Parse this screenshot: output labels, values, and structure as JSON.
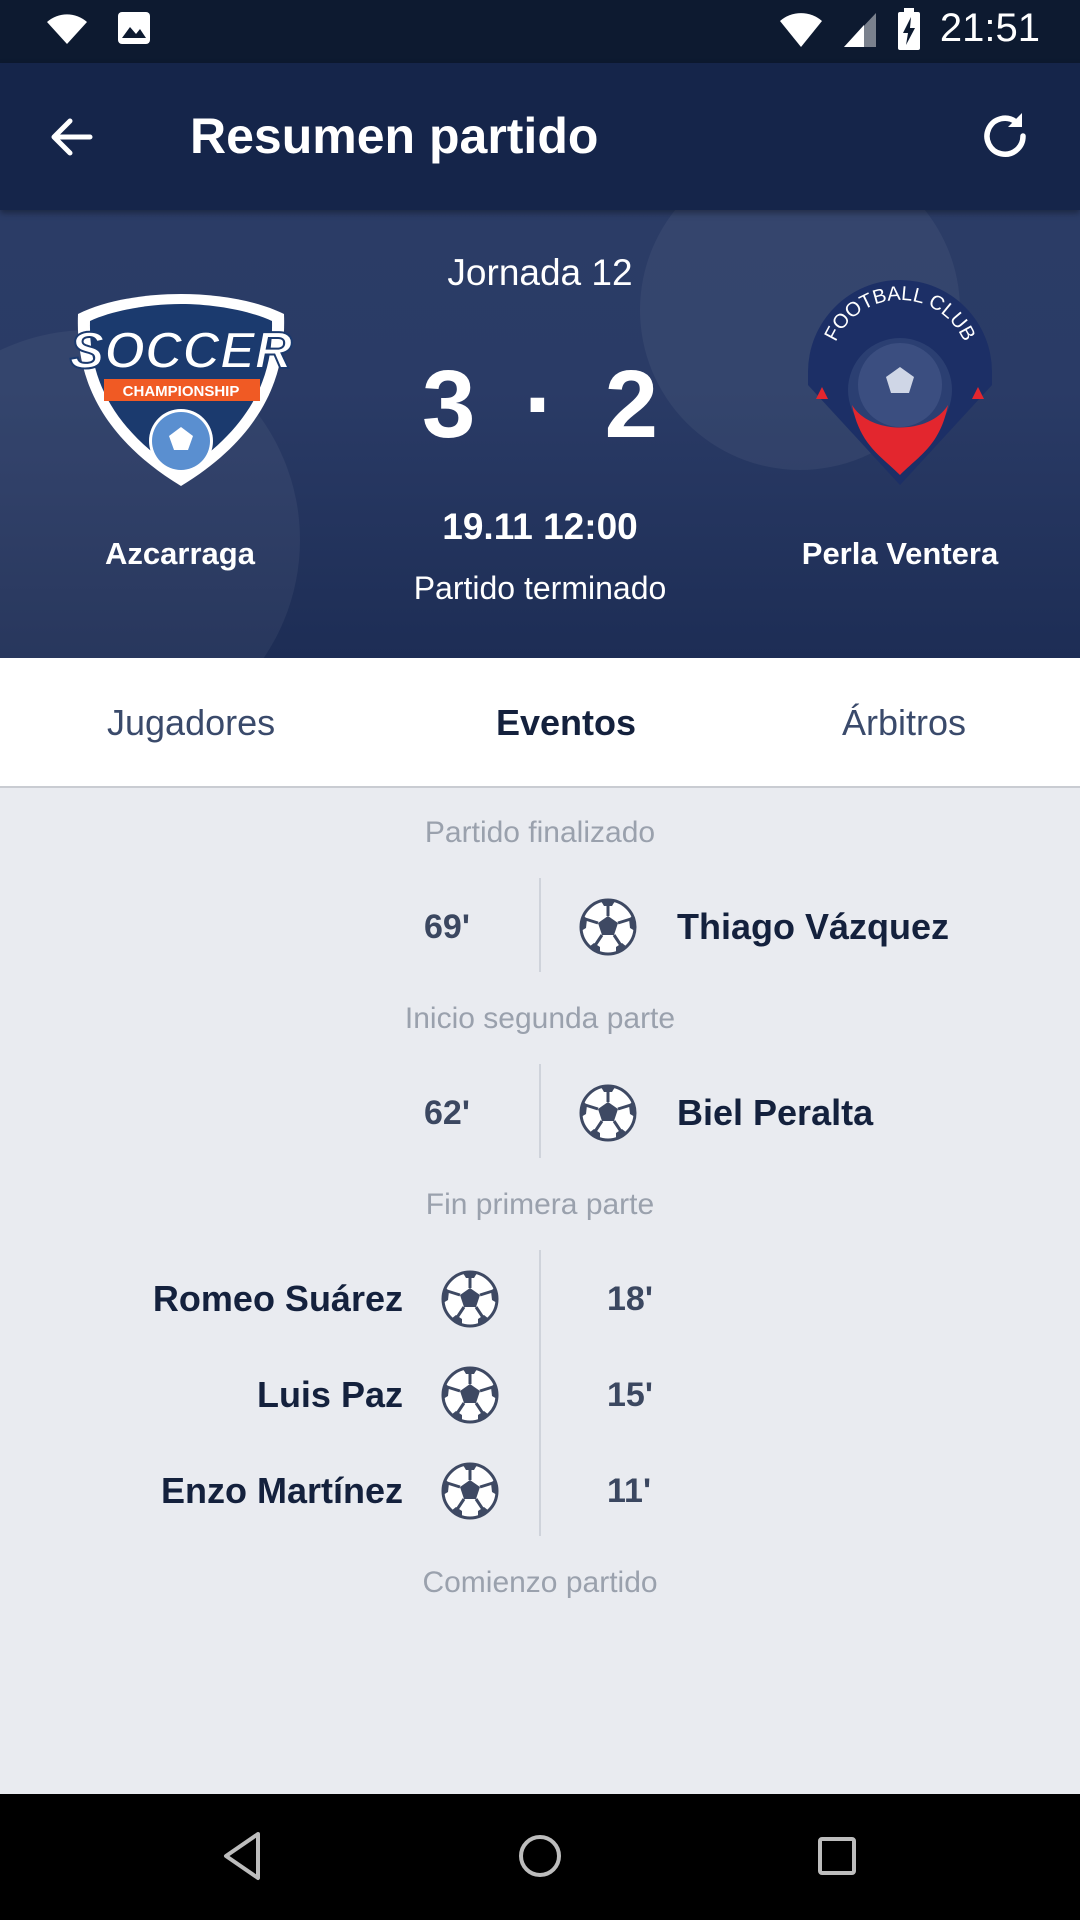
{
  "status_bar": {
    "time": "21:51"
  },
  "app_bar": {
    "title": "Resumen partido"
  },
  "match": {
    "round": "Jornada 12",
    "score_home": "3",
    "score_separator": "·",
    "score_away": "2",
    "datetime": "19.11 12:00",
    "status": "Partido terminado",
    "home_team": "Azcarraga",
    "away_team": "Perla Ventera",
    "home_logo": {
      "title": "SOCCER",
      "ribbon": "CHAMPIONSHIP"
    },
    "away_logo": {
      "arc_text": "FOOTBALL CLUB"
    }
  },
  "tabs": [
    {
      "label": "Jugadores"
    },
    {
      "label": "Eventos"
    },
    {
      "label": "Árbitros"
    }
  ],
  "events": {
    "sep_end": "Partido finalizado",
    "sep_second_half": "Inicio segunda parte",
    "sep_first_half_end": "Fin primera parte",
    "sep_start": "Comienzo partido",
    "second_half": [
      {
        "minute": "69'",
        "player": "Thiago Vázquez",
        "side": "away",
        "icon": "soccer-ball-icon"
      },
      {
        "minute": "62'",
        "player": "Biel Peralta",
        "side": "away",
        "icon": "soccer-ball-icon"
      }
    ],
    "first_half": [
      {
        "minute": "18'",
        "player": "Romeo Suárez",
        "side": "home",
        "icon": "soccer-ball-icon"
      },
      {
        "minute": "15'",
        "player": "Luis Paz",
        "side": "home",
        "icon": "soccer-ball-icon"
      },
      {
        "minute": "11'",
        "player": "Enzo Martínez",
        "side": "home",
        "icon": "soccer-ball-icon"
      }
    ]
  },
  "colors": {
    "header_dark": "#15254a",
    "header_gradient": "#2b3c66",
    "accent_orange": "#f05a24",
    "accent_red": "#e3262e",
    "text_dark": "#14213d"
  }
}
